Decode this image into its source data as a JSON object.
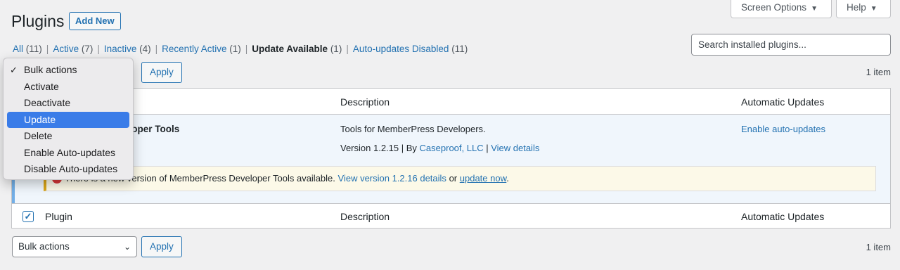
{
  "header": {
    "title": "Plugins",
    "add_new": "Add New",
    "screen_options": "Screen Options",
    "help": "Help"
  },
  "filters": [
    {
      "label": "All",
      "count": "(11)"
    },
    {
      "label": "Active",
      "count": "(7)"
    },
    {
      "label": "Inactive",
      "count": "(4)"
    },
    {
      "label": "Recently Active",
      "count": "(1)"
    },
    {
      "label": "Update Available",
      "count": "(1)"
    },
    {
      "label": "Auto-updates Disabled",
      "count": "(11)"
    }
  ],
  "search": {
    "placeholder": "Search installed plugins..."
  },
  "tablenav": {
    "apply": "Apply",
    "items": "1 item",
    "bulk_label": "Bulk actions"
  },
  "bulk_menu": {
    "items": [
      "Bulk actions",
      "Activate",
      "Deactivate",
      "Update",
      "Delete",
      "Enable Auto-updates",
      "Disable Auto-updates"
    ],
    "checked": "Bulk actions",
    "highlighted": "Update"
  },
  "table": {
    "columns": [
      "Plugin",
      "Description",
      "Automatic Updates"
    ],
    "row": {
      "name_visible": "eloper Tools",
      "description": "Tools for MemberPress Developers.",
      "version": "Version 1.2.15",
      "by": "By",
      "author": "Caseproof, LLC",
      "view_details": "View details",
      "auto_updates": "Enable auto-updates"
    },
    "notice": {
      "text_start": "There is a new version of MemberPress Developer Tools available.",
      "view_version": "View version 1.2.16 details",
      "or": "or",
      "update_now": "update now",
      "end": "."
    },
    "footer_checked": true
  },
  "colors": {
    "accent": "#2271b1",
    "active_row_bg": "#f0f6fc",
    "active_row_border": "#72aee6",
    "notice_bg": "#fcf9e8",
    "notice_border": "#dba617",
    "menu_highlight": "#3a7ce8"
  }
}
